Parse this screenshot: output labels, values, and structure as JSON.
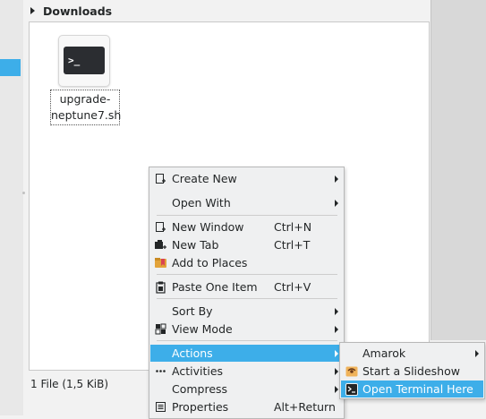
{
  "folder": {
    "group_title": "Downloads"
  },
  "file": {
    "name": "upgrade-neptune7.sh",
    "icon_glyph": ">_",
    "icon": "terminal-script-icon"
  },
  "status": {
    "text": "1 File (1,5 KiB)"
  },
  "context_menu": {
    "items": [
      {
        "label": "Create New",
        "icon": "create-new-icon"
      },
      {
        "label": "Open With"
      },
      {
        "label": "New Window",
        "shortcut": "Ctrl+N",
        "icon": "new-window-icon"
      },
      {
        "label": "New Tab",
        "shortcut": "Ctrl+T",
        "icon": "new-tab-icon"
      },
      {
        "label": "Add to Places",
        "icon": "bookmark-icon"
      },
      {
        "label": "Paste One Item",
        "shortcut": "Ctrl+V",
        "icon": "paste-icon"
      },
      {
        "label": "Sort By"
      },
      {
        "label": "View Mode",
        "icon": "view-mode-icon"
      },
      {
        "label": "Actions"
      },
      {
        "label": "Activities",
        "icon": "activities-icon"
      },
      {
        "label": "Compress"
      },
      {
        "label": "Properties",
        "shortcut": "Alt+Return",
        "icon": "properties-icon"
      }
    ]
  },
  "actions_submenu": {
    "items": [
      {
        "label": "Amarok"
      },
      {
        "label": "Start a Slideshow",
        "icon": "slideshow-icon"
      },
      {
        "label": "Open Terminal Here",
        "icon": "terminal-icon"
      }
    ]
  },
  "colors": {
    "accent": "#3daee9",
    "menu_bg": "#eff0f1"
  }
}
